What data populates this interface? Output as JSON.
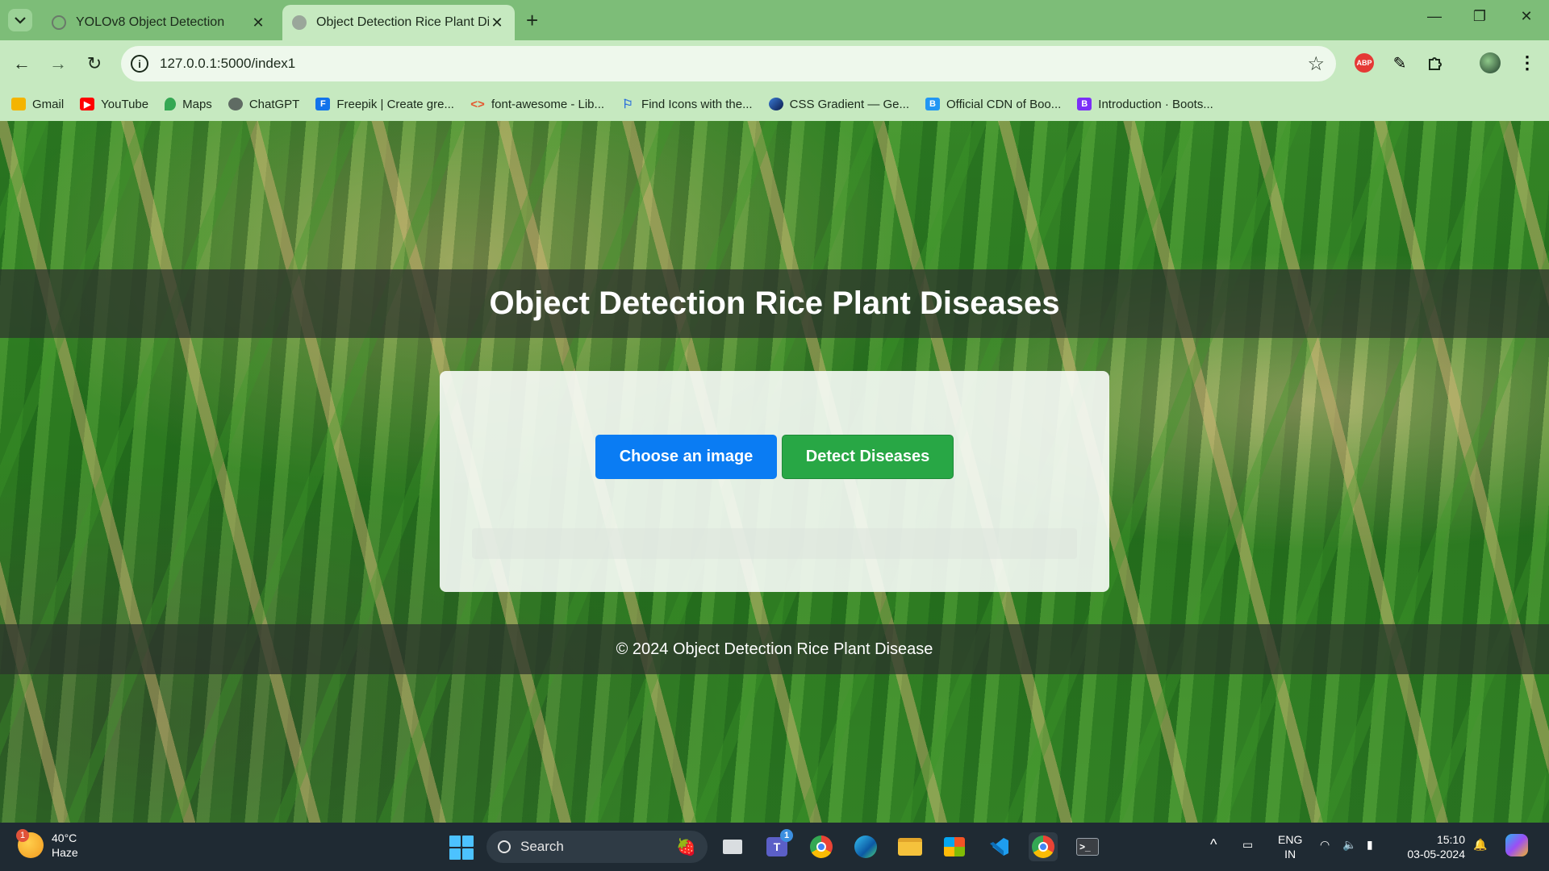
{
  "browser": {
    "tabs": [
      {
        "title": "YOLOv8 Object Detection",
        "active": false
      },
      {
        "title": "Object Detection Rice Plant Dise",
        "active": true
      }
    ],
    "url": "127.0.0.1:5000/index1",
    "ext_abp": "ABP",
    "bookmarks": [
      {
        "label": "Gmail",
        "icon": "gmail-icon",
        "color": "#f4b400"
      },
      {
        "label": "YouTube",
        "icon": "youtube-icon",
        "color": "#ff0000"
      },
      {
        "label": "Maps",
        "icon": "maps-icon",
        "color": "#34a853"
      },
      {
        "label": "ChatGPT",
        "icon": "chatgpt-icon",
        "color": "#5f6b63"
      },
      {
        "label": "Freepik | Create gre...",
        "icon": "freepik-icon",
        "color": "#1273eb"
      },
      {
        "label": "font-awesome - Lib...",
        "icon": "code-icon",
        "color": "#e4572e"
      },
      {
        "label": "Find Icons with the...",
        "icon": "flag-icon",
        "color": "#2a6fdb"
      },
      {
        "label": "CSS Gradient — Ge...",
        "icon": "gradient-icon",
        "color": "#1d3c8f"
      },
      {
        "label": "Official CDN of Boo...",
        "icon": "b-icon",
        "color": "#2196f3",
        "glyph": "B"
      },
      {
        "label": "Introduction · Boots...",
        "icon": "bootstrap-icon",
        "color": "#7b2ff7",
        "glyph": "B"
      }
    ]
  },
  "page": {
    "title": "Object Detection Rice Plant Diseases",
    "choose_label": "Choose an image",
    "detect_label": "Detect Diseases",
    "footer": "© 2024 Object Detection Rice Plant Disease"
  },
  "taskbar": {
    "weather_badge": "1",
    "temperature": "40°C",
    "condition": "Haze",
    "search_placeholder": "Search",
    "teams_badge": "1",
    "lang_top": "ENG",
    "lang_bottom": "IN",
    "time": "15:10",
    "date": "03-05-2024"
  },
  "colors": {
    "choose_button": "#0a7cf3",
    "detect_button": "#28a745",
    "chrome_green": "#7dbd78",
    "toolbar_green": "#c6e9c0"
  }
}
